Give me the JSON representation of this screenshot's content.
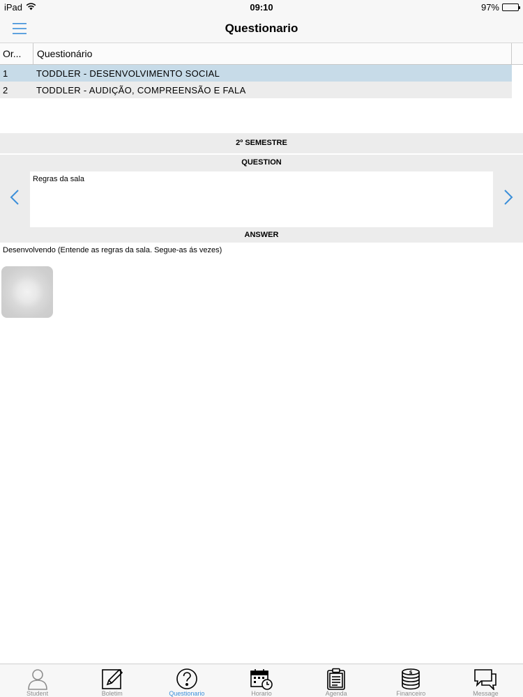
{
  "status_bar": {
    "device": "iPad",
    "time": "09:10",
    "battery": "97%",
    "battery_level": 0.97
  },
  "nav": {
    "title": "Questionario",
    "menu_icon": "hamburger-menu-icon"
  },
  "grid": {
    "columns": [
      "Or...",
      "Questionário"
    ],
    "rows": [
      {
        "ord": "1",
        "name": "TODDLER - DESENVOLVIMENTO SOCIAL",
        "selected": true
      },
      {
        "ord": "2",
        "name": "TODDLER - AUDIÇÃO, COMPREENSÃO E FALA",
        "selected": false
      }
    ]
  },
  "detail": {
    "semester": "2º SEMESTRE",
    "question_label": "QUESTION",
    "question_text": "Regras da sala",
    "answer_label": "ANSWER",
    "answer_text": "Desenvolvendo (Entende as regras da sala. Segue-as ás vezes)"
  },
  "tabs": [
    {
      "label": "Student",
      "icon": "person-icon",
      "active": false
    },
    {
      "label": "Boletim",
      "icon": "pencil-icon",
      "active": false
    },
    {
      "label": "Questionario",
      "icon": "question-icon",
      "active": true
    },
    {
      "label": "Horario",
      "icon": "calendar-clock-icon",
      "active": false
    },
    {
      "label": "Agenda",
      "icon": "clipboard-icon",
      "active": false
    },
    {
      "label": "Financeiro",
      "icon": "coins-icon",
      "active": false
    },
    {
      "label": "Message",
      "icon": "chat-bubbles-icon",
      "active": false
    }
  ],
  "colors": {
    "accent": "#3b8fd9",
    "selected_row": "#c7dbe8",
    "row": "#ececec"
  }
}
